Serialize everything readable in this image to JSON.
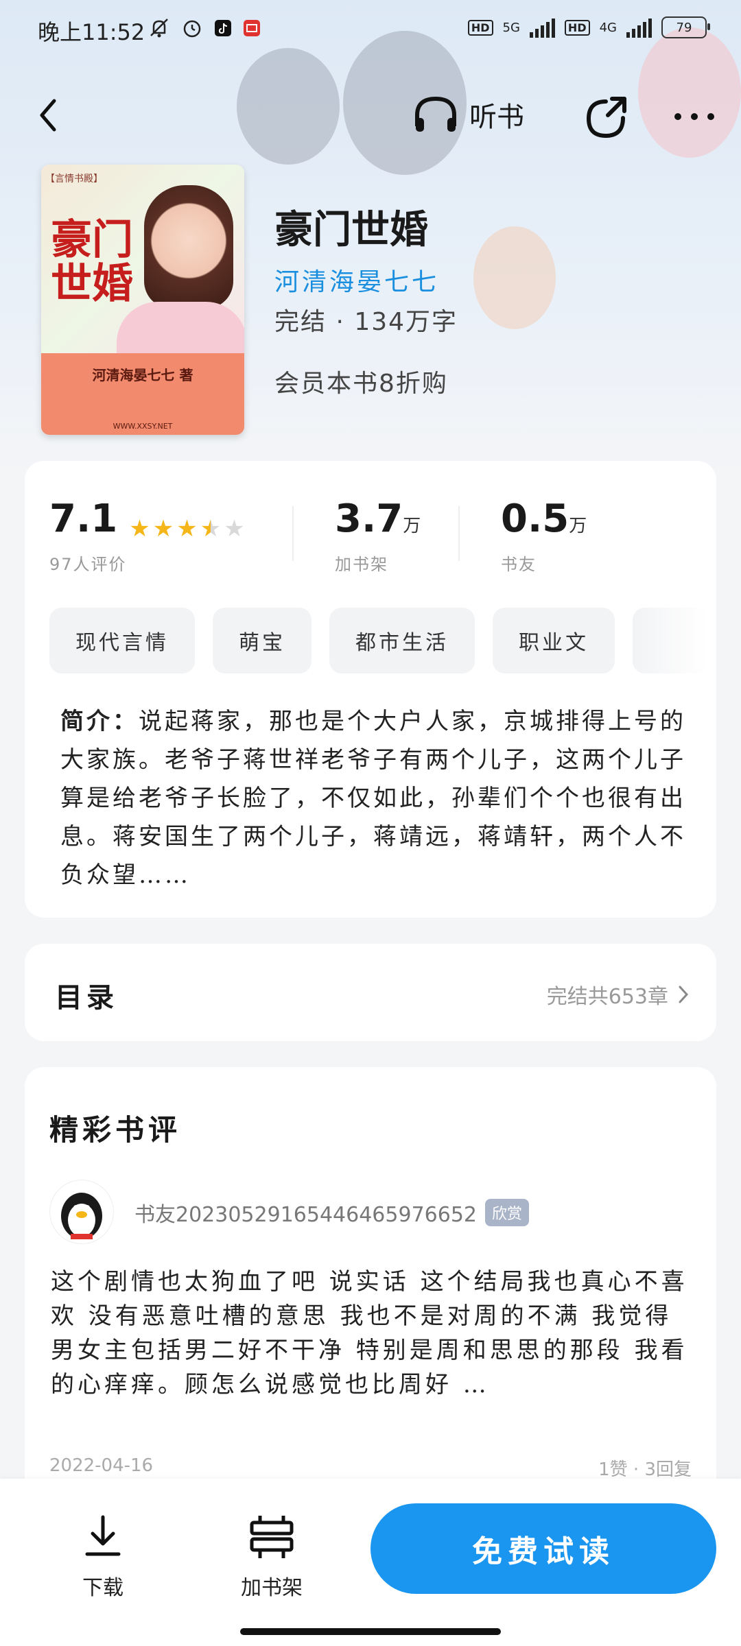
{
  "status": {
    "time": "晚上11:52",
    "network1": "5G",
    "network2": "4G",
    "battery": "79"
  },
  "nav": {
    "listen_label": "听书"
  },
  "book": {
    "title": "豪门世婚",
    "author": "河清海晏七七",
    "status_words": "完结 · 134万字",
    "promo": "会员本书8折购",
    "cover": {
      "label": "【言情书殿】",
      "title": "豪门世婚",
      "author": "河清海晏七七 著",
      "site": "WWW.XXSY.NET"
    }
  },
  "stats": {
    "rating": "7.1",
    "rating_stars": 3.5,
    "rating_count": "97人评价",
    "shelf_num": "3.7",
    "shelf_unit": "万",
    "shelf_label": "加书架",
    "friends_num": "0.5",
    "friends_unit": "万",
    "friends_label": "书友"
  },
  "tags": [
    "现代言情",
    "萌宝",
    "都市生活",
    "职业文"
  ],
  "intro": {
    "label": "简介：",
    "text": "说起蒋家，那也是个大户人家，京城排得上号的大家族。老爷子蒋世祥老爷子有两个儿子，这两个儿子算是给老爷子长脸了，不仅如此，孙辈们个个也很有出息。蒋安国生了两个儿子，蒋靖远，蒋靖轩，两个人不负众望……"
  },
  "toc": {
    "title": "目录",
    "info": "完结共653章"
  },
  "reviews": {
    "title": "精彩书评",
    "items": [
      {
        "user": "书友20230529165446465976652",
        "badge": "欣赏",
        "text": "这个剧情也太狗血了吧 说实话 这个结局我也真心不喜欢 没有恶意吐槽的意思 我也不是对周的不满 我觉得男女主包括男二好不干净 特别是周和思思的那段 我看的心痒痒。顾怎么说感觉也比周好 …",
        "date": "2022-04-16",
        "meta": "1赞 · 3回复"
      }
    ]
  },
  "bottom": {
    "download": "下载",
    "add_shelf": "加书架",
    "read_free": "免费试读"
  },
  "colors": {
    "accent": "#1b96f0",
    "author": "#1a8fe0",
    "star": "#f5b619"
  }
}
